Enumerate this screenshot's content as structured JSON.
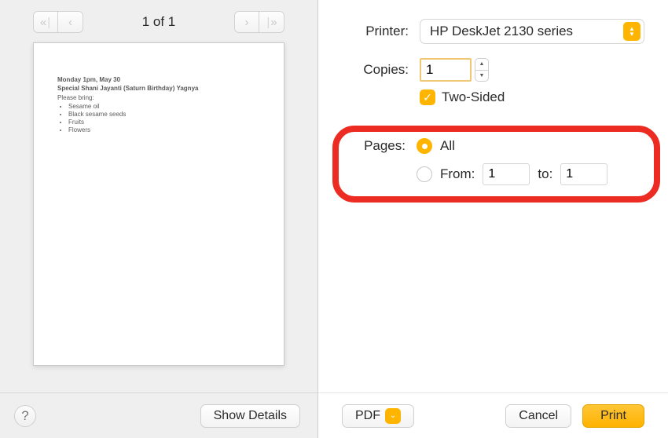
{
  "pager": {
    "counter": "1 of 1"
  },
  "preview": {
    "line1": "Monday 1pm, May 30",
    "line2": "Special Shani Jayanti (Saturn Birthday) Yagnya",
    "please_bring": "Please bring:",
    "items": [
      "Sesame oil",
      "Black sesame seeds",
      "Fruits",
      "Flowers"
    ]
  },
  "left_footer": {
    "help": "?",
    "show_details": "Show Details"
  },
  "form": {
    "printer_label": "Printer:",
    "printer_value": "HP DeskJet 2130 series",
    "copies_label": "Copies:",
    "copies_value": "1",
    "two_sided": "Two-Sided",
    "pages_label": "Pages:",
    "pages_all": "All",
    "pages_from_label": "From:",
    "pages_from": "1",
    "pages_to_label": "to:",
    "pages_to": "1"
  },
  "right_footer": {
    "pdf": "PDF",
    "cancel": "Cancel",
    "print": "Print"
  }
}
